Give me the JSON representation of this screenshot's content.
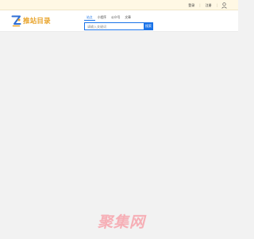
{
  "topbar": {
    "login": "登录",
    "register": "注册",
    "user_icon": "user-icon"
  },
  "logo": {
    "mark_icon": "z-logo-icon",
    "text": "推站目录",
    "color": "#e8a32a"
  },
  "search": {
    "tabs": [
      {
        "label": "站点",
        "active": true
      },
      {
        "label": "小程序",
        "active": false
      },
      {
        "label": "公众号",
        "active": false
      },
      {
        "label": "文章",
        "active": false
      }
    ],
    "placeholder": "请输入关键词",
    "button": "搜索",
    "accent": "#1a73e8"
  },
  "watermark": {
    "text": "聚集网",
    "color": "#f7a8b0"
  }
}
